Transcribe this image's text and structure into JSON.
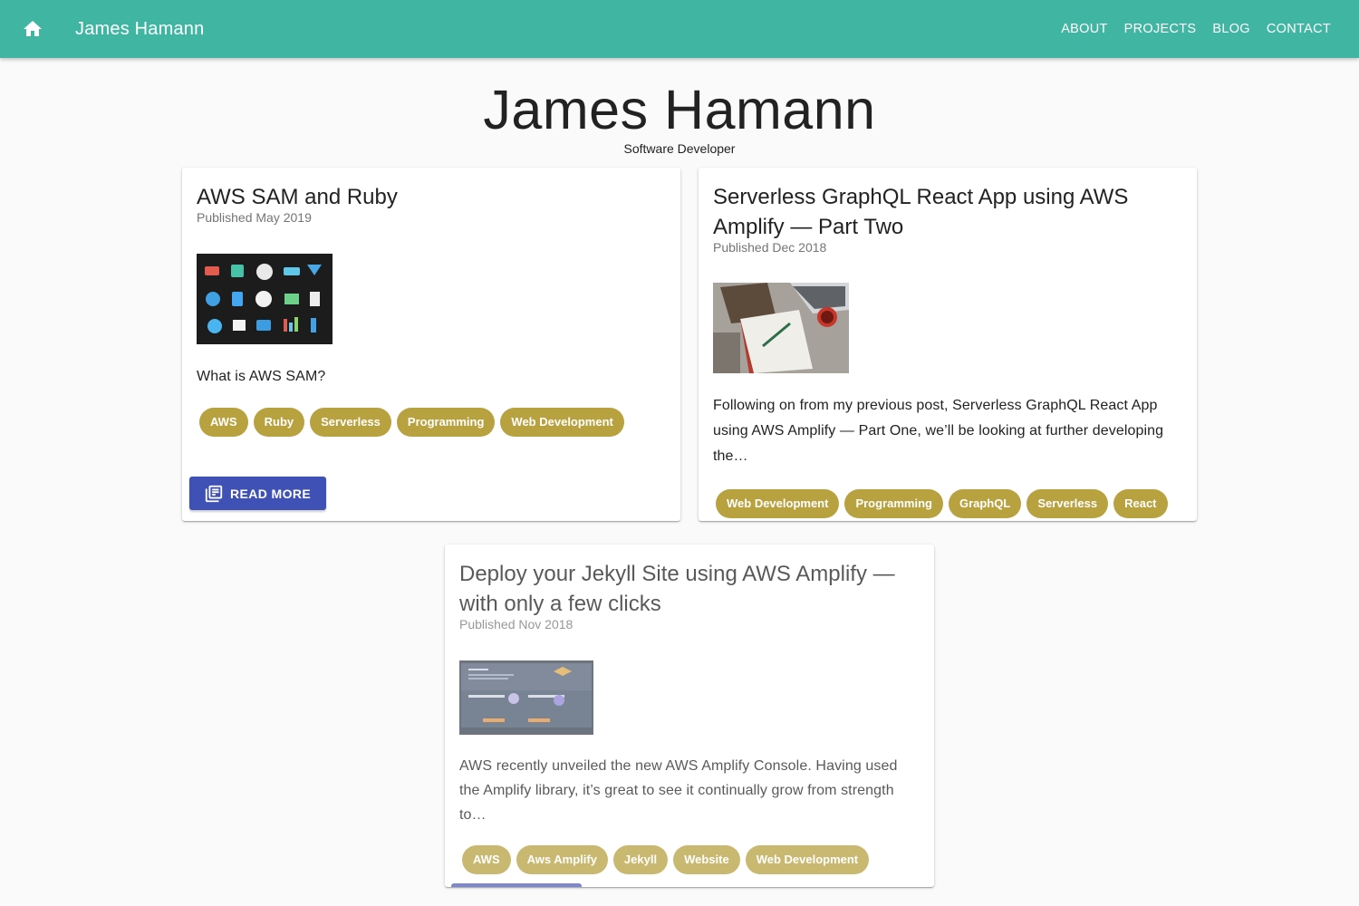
{
  "header": {
    "home_icon": "home-icon",
    "title": "James Hamann",
    "nav": [
      "ABOUT",
      "PROJECTS",
      "BLOG",
      "CONTACT"
    ],
    "background": "#40b6a2"
  },
  "hero": {
    "name": "James Hamann",
    "subtitle": "Software Developer"
  },
  "posts": [
    {
      "title": "AWS SAM and Ruby",
      "published": "Published May 2019",
      "excerpt": "What is AWS SAM?",
      "tags": [
        "AWS",
        "Ruby",
        "Serverless",
        "Programming",
        "Web Development"
      ],
      "button_label": "READ MORE",
      "button_icon": "article-icon"
    },
    {
      "title": "Serverless GraphQL React App using AWS Amplify — Part Two",
      "published": "Published Dec 2018",
      "excerpt": "Following on from my previous post, Serverless GraphQL React App using AWS Amplify — Part One, we’ll be looking at further developing the…",
      "tags": [
        "Web Development",
        "Programming",
        "GraphQL",
        "Serverless",
        "React"
      ]
    },
    {
      "title": "Deploy your Jekyll Site using AWS Amplify — with only a few clicks",
      "published": "Published Nov 2018",
      "excerpt": "AWS recently unveiled the new AWS Amplify Console. Having used the Amplify library, it’s great to see it continually grow from strength to…",
      "tags": [
        "AWS",
        "Aws Amplify",
        "Jekyll",
        "Website",
        "Web Development"
      ]
    }
  ],
  "colors": {
    "chip": "#b8a13f",
    "button": "#3f51b5",
    "page_bg": "#fafafa"
  }
}
